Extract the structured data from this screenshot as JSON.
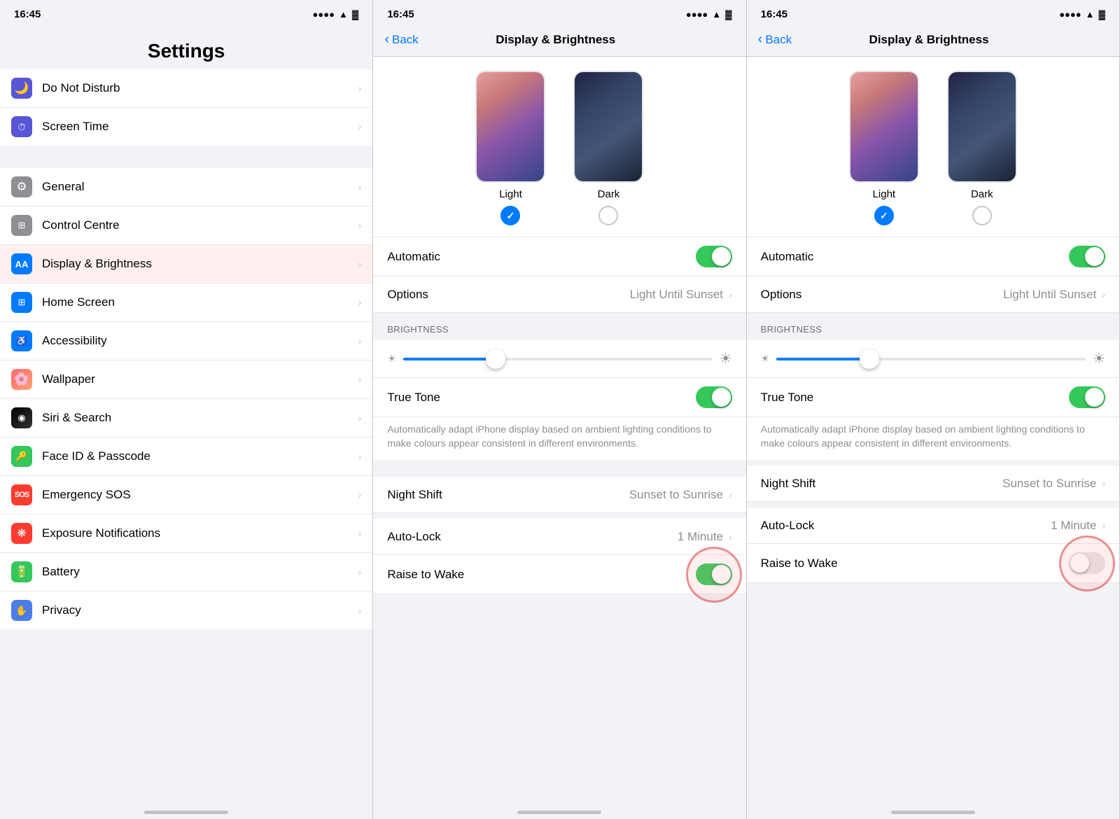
{
  "panels": {
    "settings": {
      "statusTime": "16:45",
      "title": "Settings",
      "items": [
        {
          "id": "do-not-disturb",
          "label": "Do Not Disturb",
          "iconBg": "#5856d6",
          "icon": "🌙"
        },
        {
          "id": "screen-time",
          "label": "Screen Time",
          "iconBg": "#5856d6",
          "icon": "⏱"
        },
        {
          "id": "general",
          "label": "General",
          "iconBg": "#8e8e93",
          "icon": "⚙️"
        },
        {
          "id": "control-centre",
          "label": "Control Centre",
          "iconBg": "#8e8e93",
          "icon": "🔲"
        },
        {
          "id": "display-brightness",
          "label": "Display & Brightness",
          "iconBg": "#007aff",
          "icon": "AA",
          "active": true
        },
        {
          "id": "home-screen",
          "label": "Home Screen",
          "iconBg": "#007aff",
          "icon": "⊞"
        },
        {
          "id": "accessibility",
          "label": "Accessibility",
          "iconBg": "#007aff",
          "icon": "♿"
        },
        {
          "id": "wallpaper",
          "label": "Wallpaper",
          "iconBg": "#ff9500",
          "icon": "🌸"
        },
        {
          "id": "siri-search",
          "label": "Siri & Search",
          "iconBg": "#000",
          "icon": "◉"
        },
        {
          "id": "face-id",
          "label": "Face ID & Passcode",
          "iconBg": "#34c759",
          "icon": "🔑"
        },
        {
          "id": "emergency-sos",
          "label": "Emergency SOS",
          "iconBg": "#ff3b30",
          "icon": "SOS"
        },
        {
          "id": "exposure",
          "label": "Exposure Notifications",
          "iconBg": "#ff3b30",
          "icon": "❋"
        },
        {
          "id": "battery",
          "label": "Battery",
          "iconBg": "#34c759",
          "icon": "🔋"
        },
        {
          "id": "privacy",
          "label": "Privacy",
          "iconBg": "#4a7de8",
          "icon": "✋"
        }
      ]
    },
    "db1": {
      "statusTime": "16:45",
      "backLabel": "Back",
      "title": "Display & Brightness",
      "appearance": {
        "lightLabel": "Light",
        "darkLabel": "Dark",
        "lightSelected": true
      },
      "automaticLabel": "Automatic",
      "automaticOn": true,
      "optionsLabel": "Options",
      "optionsValue": "Light Until Sunset",
      "brightnessHeader": "BRIGHTNESS",
      "brightnessValue": 30,
      "trueToneLabel": "True Tone",
      "trueToneOn": true,
      "trueToneDesc": "Automatically adapt iPhone display based on ambient lighting conditions to make colours appear consistent in different environments.",
      "nightShiftLabel": "Night Shift",
      "nightShiftValue": "Sunset to Sunrise",
      "autoLockLabel": "Auto-Lock",
      "autoLockValue": "1 Minute",
      "raiseToWakeLabel": "Raise to Wake",
      "raiseToWakeOn": true,
      "raiseToWakeHighlighted": true
    },
    "db2": {
      "statusTime": "16:45",
      "backLabel": "Back",
      "title": "Display & Brightness",
      "appearance": {
        "lightLabel": "Light",
        "darkLabel": "Dark",
        "lightSelected": true
      },
      "automaticLabel": "Automatic",
      "automaticOn": true,
      "optionsLabel": "Options",
      "optionsValue": "Light Until Sunset",
      "brightnessHeader": "BRIGHTNESS",
      "brightnessValue": 30,
      "trueToneLabel": "True Tone",
      "trueToneOn": true,
      "trueToneDesc": "Automatically adapt iPhone display based on ambient lighting conditions to make colours appear consistent in different environments.",
      "nightShiftLabel": "Night Shift",
      "nightShiftValue": "Sunset to Sunrise",
      "autoLockLabel": "Auto-Lock",
      "autoLockValue": "1 Minute",
      "raiseToWakeLabel": "Raise to Wake",
      "raiseToWakeOn": false,
      "raiseToWakeHighlighted": true
    }
  },
  "icons": {
    "signal": "▐▐▐▐",
    "wifi": "WiFi",
    "battery": "🔋",
    "chevron": "›",
    "back": "‹"
  },
  "colors": {
    "blue": "#007aff",
    "green": "#34c759",
    "gray": "#8e8e93",
    "lightGray": "#e5e5ea",
    "red": "#ff3b30"
  }
}
